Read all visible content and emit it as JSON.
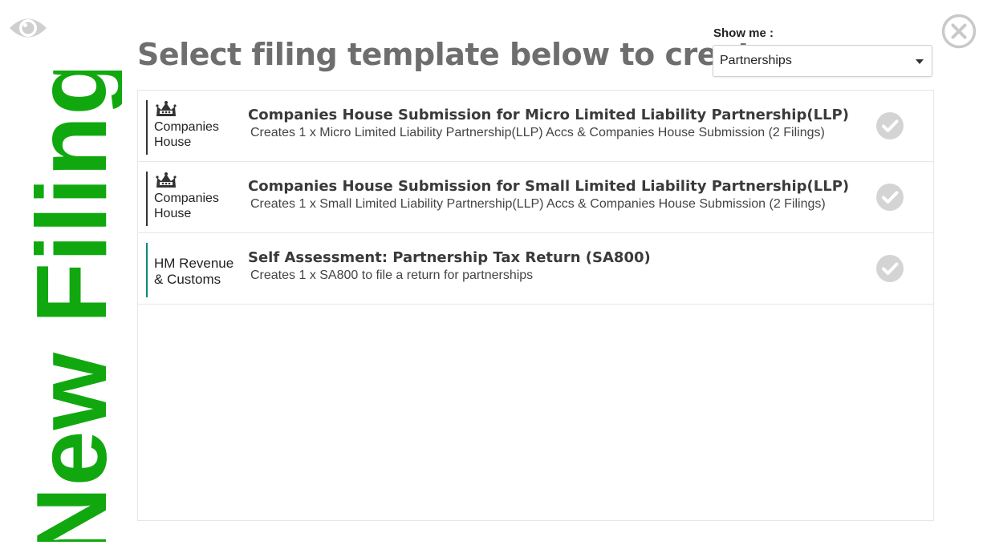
{
  "colors": {
    "banner_green": "#11a80f",
    "title_gray": "#6e6e6e",
    "icon_gray": "#c9c9c9",
    "check_gray": "#d4d4d4"
  },
  "banner": {
    "text": "New Filing"
  },
  "header": {
    "title": "Select filing template below to create",
    "eye_icon": "eye-icon",
    "close_icon": "close-icon"
  },
  "filter": {
    "label": "Show me :",
    "selected": "Partnerships"
  },
  "templates": [
    {
      "org": "Companies\nHouse",
      "org_icon": "crown-crest-icon",
      "title": "Companies House Submission for Micro Limited Liability Partnership(LLP)",
      "description": "Creates 1 x Micro Limited Liability Partnership(LLP) Accs & Companies House Submission (2 Filings)",
      "status_icon": "check-circle-icon"
    },
    {
      "org": "Companies\nHouse",
      "org_icon": "crown-crest-icon",
      "title": "Companies House Submission for Small Limited Liability Partnership(LLP)",
      "description": "Creates 1 x Small Limited Liability Partnership(LLP) Accs & Companies House Submission (2 Filings)",
      "status_icon": "check-circle-icon"
    },
    {
      "org": "HM Revenue\n& Customs",
      "org_icon": "",
      "title": "Self Assessment: Partnership Tax Return (SA800)",
      "description": "Creates 1 x SA800 to file a return for partnerships",
      "status_icon": "check-circle-icon"
    }
  ]
}
